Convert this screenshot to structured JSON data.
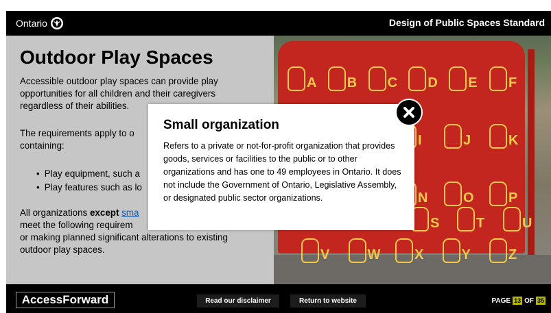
{
  "header": {
    "brand": "Ontario",
    "brand_icon": "trillium-logo-icon",
    "standard_title": "Design of Public Spaces Standard"
  },
  "main": {
    "heading": "Outdoor Play Spaces",
    "paragraph1": "Accessible outdoor play spaces can provide play opportunities for all children and their caregivers regardless of their abilities.",
    "paragraph2_visible": "The requirements apply to o",
    "paragraph2_line2": "containing:",
    "bullets": [
      "Play equipment, such a",
      "Play features such as lo"
    ],
    "p3_start": "All organizations ",
    "p3_bold": "except",
    "p3_link": "sma",
    "p3_line2": "meet the following requirem",
    "p3_rest": "or making planned significant alterations to existing outdoor play spaces."
  },
  "photo": {
    "letters_row1": [
      "A",
      "B",
      "C",
      "D",
      "E",
      "F"
    ],
    "letters_row2": [
      "I",
      "J",
      "K"
    ],
    "letters_row3": [
      "N",
      "O",
      "P"
    ],
    "letters_row4": [
      "S",
      "T",
      "U"
    ],
    "letters_row5": [
      "V",
      "W",
      "X",
      "Y",
      "Z"
    ]
  },
  "modal": {
    "title": "Small organization",
    "body": "Refers to a private or not-for-profit organization that provides goods, services or facilities to the public or to other organizations and has one to 49 employees in Ontario. It does not include the Government of Ontario, Legislative Assembly, or designated public sector organizations.",
    "close_icon": "close-icon"
  },
  "footer": {
    "app_name": "AccessForward",
    "disclaimer_button": "Read our disclaimer",
    "return_button": "Return to website",
    "page_label": "PAGE",
    "page_current": "13",
    "page_of": "OF",
    "page_total": "35"
  },
  "colors": {
    "accent_page_box": "#b8b800",
    "panel_grey": "#c6c6c6",
    "board_red": "#c2261f",
    "letter_yellow": "#f3c94c",
    "link_blue": "#1a5fb4"
  }
}
